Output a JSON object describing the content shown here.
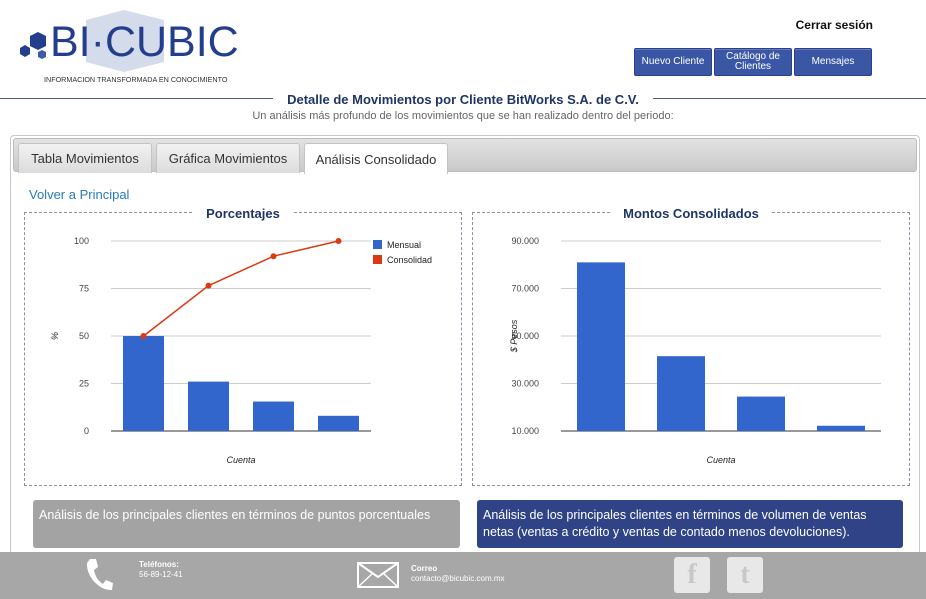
{
  "header": {
    "logo_text": "BI·CUBIC",
    "logo_tagline": "INFORMACION TRANSFORMADA EN CONOCIMIENTO",
    "logout": "Cerrar sesión",
    "nav": {
      "new_client": "Nuevo Cliente",
      "catalog": "Catálogo de Clientes",
      "messages": "Mensajes"
    }
  },
  "page": {
    "title": "Detalle de Movimientos por Cliente BitWorks S.A. de C.V.",
    "subtitle": "Un análisis más profundo de los movimientos que se han realizado dentro del periodo:"
  },
  "tabs": {
    "tabla": "Tabla Movimientos",
    "grafica": "Gráfica Movimientos",
    "analisis": "Análisis Consolidado",
    "active": "analisis"
  },
  "back_link": "Volver a Principal",
  "colors": {
    "bar": "#3366cc",
    "line": "#dc3912",
    "nav": "#3a57a6",
    "info_right": "#2f4386"
  },
  "chart_data": [
    {
      "type": "bar",
      "box_title": "Porcentajes",
      "xlabel": "Cuenta",
      "ylabel": "%",
      "ylim": [
        0,
        100
      ],
      "yticks": [
        0,
        25,
        50,
        75,
        100
      ],
      "ytick_labels": [
        "0",
        "25",
        "50",
        "75",
        "100"
      ],
      "grid": true,
      "legend_position": "right",
      "series": [
        {
          "name": "Mensual",
          "type": "bar",
          "values": [
            50,
            26,
            15.5,
            8
          ]
        },
        {
          "name": "Consolidad",
          "type": "line",
          "values": [
            50,
            76.5,
            92,
            100
          ]
        }
      ]
    },
    {
      "type": "bar",
      "box_title": "Montos Consolidados",
      "xlabel": "Cuenta",
      "ylabel": "$ Pesos",
      "ylim": [
        10000,
        90000
      ],
      "yticks": [
        10000,
        30000,
        50000,
        70000,
        90000
      ],
      "ytick_labels": [
        "10.000",
        "30.000",
        "50.000",
        "70.000",
        "90.000"
      ],
      "grid": true,
      "series": [
        {
          "name": "",
          "values": [
            81000,
            41500,
            24500,
            12200
          ]
        }
      ]
    }
  ],
  "info": {
    "left": "Análisis de los principales clientes en términos de puntos porcentuales",
    "right": "Análisis de los principales clientes en términos de volumen de ventas netas (ventas a crédito y ventas de contado menos devoluciones)."
  },
  "footer": {
    "phone_label": "Teléfonos:",
    "phone": "56-89-12-41",
    "email_label": "Correo",
    "email": "contacto@bicubic.com.mx",
    "facebook_icon": "facebook-icon",
    "twitter_icon": "twitter-icon"
  }
}
